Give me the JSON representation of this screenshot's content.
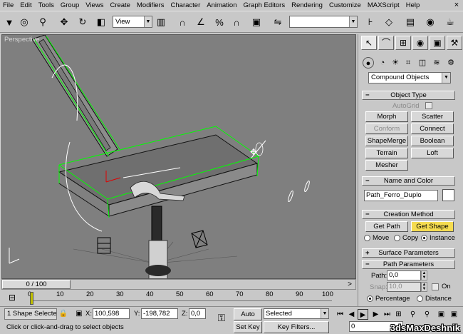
{
  "menubar": {
    "items": [
      "File",
      "Edit",
      "Tools",
      "Group",
      "Views",
      "Create",
      "Modifiers",
      "Character",
      "Animation",
      "Graph Editors",
      "Rendering",
      "Customize",
      "MAXScript",
      "Help"
    ],
    "close": "×"
  },
  "toolbar": {
    "reference_coord": "View",
    "named_selection": ""
  },
  "viewport": {
    "label": "Perspective"
  },
  "timeline": {
    "frame_indicator": "0 / 100",
    "next": ">",
    "ticks": [
      "0",
      "10",
      "20",
      "30",
      "40",
      "50",
      "60",
      "70",
      "80",
      "90",
      "100"
    ]
  },
  "status": {
    "selection": "1 Shape Selecte",
    "x_label": "X:",
    "x_value": "100,598",
    "y_label": "Y:",
    "y_value": "-198,782",
    "z_label": "Z:",
    "z_value": "0,0",
    "auto_key": "Auto Key",
    "key_mode": "Selected",
    "set_key": "Set Key",
    "key_filters": "Key Filters...",
    "current_frame": "0",
    "prompt": "Click or click-and-drag to select objects"
  },
  "command_panel": {
    "category": "Compound Objects",
    "object_type": {
      "title": "Object Type",
      "autogrid": "AutoGrid",
      "buttons": [
        "Morph",
        "Scatter",
        "Conform",
        "Connect",
        "ShapeMerge",
        "Boolean",
        "Terrain",
        "Loft",
        "Mesher"
      ]
    },
    "name_color": {
      "title": "Name and Color",
      "name": "Path_Ferro_Duplo",
      "color": "#ffffff"
    },
    "creation_method": {
      "title": "Creation Method",
      "get_path": "Get Path",
      "get_shape": "Get Shape",
      "move": "Move",
      "copy": "Copy",
      "instance": "Instance"
    },
    "surface_parameters": {
      "title": "Surface Parameters"
    },
    "path_parameters": {
      "title": "Path Parameters",
      "path_label": "Path:",
      "path_value": "0,0",
      "snap_label": "Snap:",
      "snap_value": "10,0",
      "on_label": "On",
      "percentage": "Percentage",
      "distance": "Distance"
    }
  },
  "watermark": "3dsMaxDeshnik",
  "colors": {
    "viewport_bg": "#7f7f7f",
    "selection_green": "#00ff00",
    "active_button": "#f5dc50"
  }
}
